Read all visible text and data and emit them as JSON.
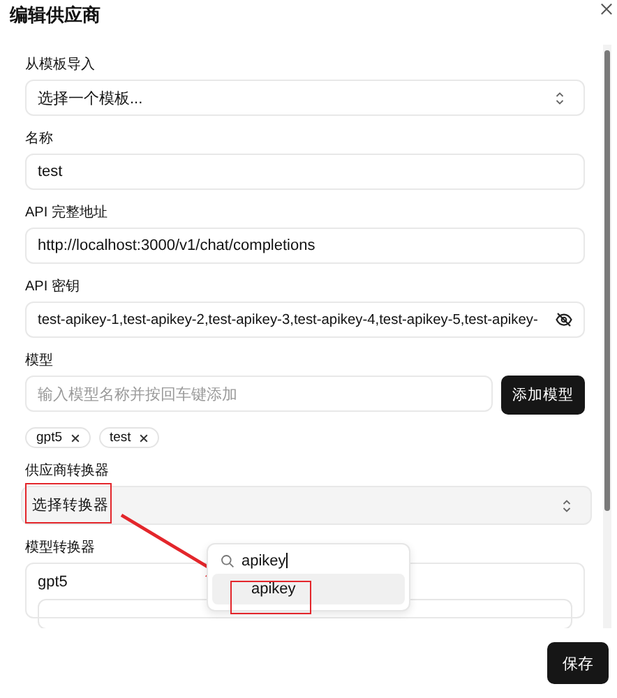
{
  "dialog": {
    "title": "编辑供应商"
  },
  "fields": [
    {
      "kind": "select",
      "label": "从模板导入",
      "value": "选择一个模板..."
    },
    {
      "kind": "text",
      "label": "名称",
      "value": "test"
    },
    {
      "kind": "text",
      "label": "API 完整地址",
      "value": "http://localhost:3000/v1/chat/completions"
    },
    {
      "kind": "secret",
      "label": "API 密钥",
      "value": "test-apikey-1,test-apikey-2,test-apikey-3,test-apikey-4,test-apikey-5,test-apikey-"
    }
  ],
  "models": {
    "label": "模型",
    "placeholder": "输入模型名称并按回车键添加",
    "add_button": "添加模型",
    "tags": [
      "gpt5",
      "test"
    ]
  },
  "provider_transformer": {
    "label": "供应商转换器",
    "value": "选择转换器",
    "dropdown": {
      "search": "apikey",
      "options": [
        {
          "label": "apikey",
          "selected": true
        }
      ]
    }
  },
  "model_transformer": {
    "label": "模型转换器",
    "models": [
      {
        "name": "gpt5"
      }
    ]
  },
  "footer": {
    "save_button": "保存"
  }
}
